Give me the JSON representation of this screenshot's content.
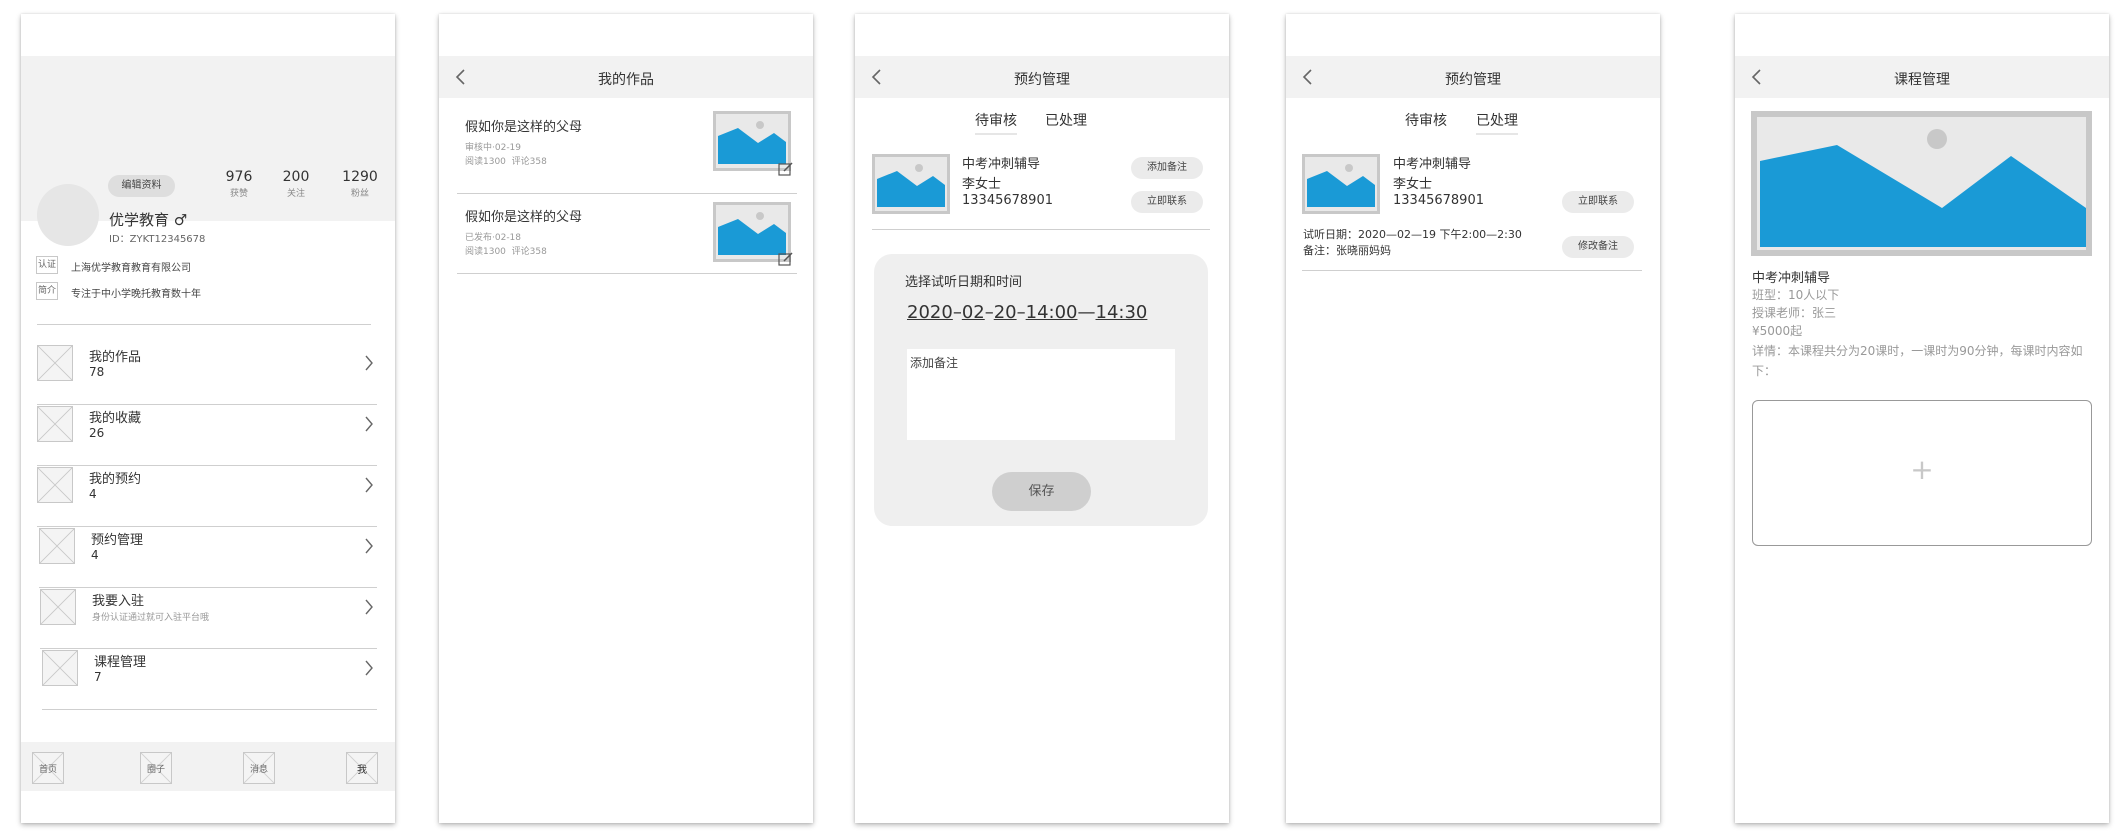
{
  "profile": {
    "edit_label": "编辑资料",
    "stats": [
      {
        "value": "976",
        "label": "获赞"
      },
      {
        "value": "200",
        "label": "关注"
      },
      {
        "value": "1290",
        "label": "粉丝"
      }
    ],
    "name": "优学教育 ♂",
    "id_text": "ID：ZYKT12345678",
    "cert_tag": "认证",
    "cert_text": "上海优学教育教育有限公司",
    "intro_tag": "简介",
    "intro_text": "专注于中小学晚托教育数十年",
    "menu": [
      {
        "title": "我的作品",
        "sub": "78"
      },
      {
        "title": "我的收藏",
        "sub": "26"
      },
      {
        "title": "我的预约",
        "sub": "4"
      },
      {
        "title": "预约管理",
        "sub": "4"
      },
      {
        "title": "我要入驻",
        "sub": "身份认证通过就可入驻平台哦"
      },
      {
        "title": "课程管理",
        "sub": "7"
      }
    ],
    "tabbar": [
      "首页",
      "圈子",
      "消息",
      "我"
    ]
  },
  "works": {
    "title": "我的作品",
    "items": [
      {
        "title": "假如你是这样的父母",
        "status": "审核中·02-19",
        "stats": "阅读1300  评论358"
      },
      {
        "title": "假如你是这样的父母",
        "status": "已发布·02-18",
        "stats": "阅读1300  评论358"
      }
    ]
  },
  "booking_pending": {
    "title": "预约管理",
    "tabs": [
      "待审核",
      "已处理"
    ],
    "card": {
      "course": "中考冲刺辅导",
      "person": "李女士",
      "phone": "13345678901",
      "btn_note": "添加备注",
      "btn_contact": "立即联系"
    },
    "panel": {
      "heading": "选择试听日期和时间",
      "date_parts": [
        "2020",
        "02",
        "20",
        "14:00",
        "14:30"
      ],
      "note_placeholder": "添加备注",
      "save_label": "保存"
    }
  },
  "booking_done": {
    "title": "预约管理",
    "tabs": [
      "待审核",
      "已处理"
    ],
    "card": {
      "course": "中考冲刺辅导",
      "person": "李女士",
      "phone": "13345678901",
      "btn_contact": "立即联系",
      "btn_edit_note": "修改备注"
    },
    "trial_date": "试听日期：2020—02—19 下午2:00—2:30",
    "note": "备注：张晓丽妈妈"
  },
  "course": {
    "title": "课程管理",
    "name": "中考冲刺辅导",
    "class_type": "班型：10人以下",
    "teacher": "授课老师：张三",
    "price": "¥5000起",
    "detail": "详情：本课程共分为20课时，一课时为90分钟，每课时内容如下：",
    "add_symbol": "+"
  },
  "colors": {
    "accent": "#1a9ad6",
    "navbar": "#f2f2f2",
    "placeholder_border": "#c8c8c8"
  }
}
